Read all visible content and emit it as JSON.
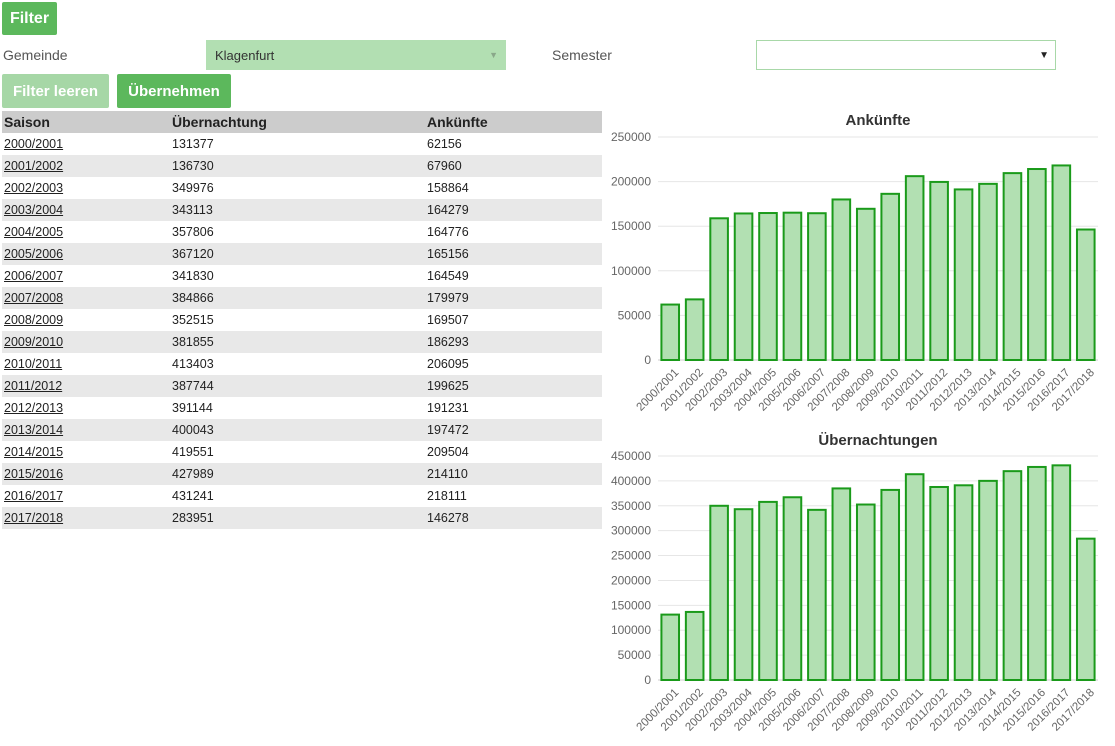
{
  "buttons": {
    "filter": "Filter",
    "clear": "Filter leeren",
    "apply": "Übernehmen"
  },
  "filters": {
    "gemeinde_label": "Gemeinde",
    "gemeinde_value": "Klagenfurt",
    "semester_label": "Semester",
    "semester_value": ""
  },
  "table": {
    "headers": [
      "Saison",
      "Übernachtung",
      "Ankünfte"
    ],
    "rows": [
      [
        "2000/2001",
        "131377",
        "62156"
      ],
      [
        "2001/2002",
        "136730",
        "67960"
      ],
      [
        "2002/2003",
        "349976",
        "158864"
      ],
      [
        "2003/2004",
        "343113",
        "164279"
      ],
      [
        "2004/2005",
        "357806",
        "164776"
      ],
      [
        "2005/2006",
        "367120",
        "165156"
      ],
      [
        "2006/2007",
        "341830",
        "164549"
      ],
      [
        "2007/2008",
        "384866",
        "179979"
      ],
      [
        "2008/2009",
        "352515",
        "169507"
      ],
      [
        "2009/2010",
        "381855",
        "186293"
      ],
      [
        "2010/2011",
        "413403",
        "206095"
      ],
      [
        "2011/2012",
        "387744",
        "199625"
      ],
      [
        "2012/2013",
        "391144",
        "191231"
      ],
      [
        "2013/2014",
        "400043",
        "197472"
      ],
      [
        "2014/2015",
        "419551",
        "209504"
      ],
      [
        "2015/2016",
        "427989",
        "214110"
      ],
      [
        "2016/2017",
        "431241",
        "218111"
      ],
      [
        "2017/2018",
        "283951",
        "146278"
      ]
    ]
  },
  "colors": {
    "bar_fill": "#b2e0b2",
    "bar_stroke": "#1a9a1a",
    "button": "#5cb85c",
    "button_disabled": "#a6d7a6"
  },
  "chart_data": [
    {
      "type": "bar",
      "title": "Ankünfte",
      "categories": [
        "2000/2001",
        "2001/2002",
        "2002/2003",
        "2003/2004",
        "2004/2005",
        "2005/2006",
        "2006/2007",
        "2007/2008",
        "2008/2009",
        "2009/2010",
        "2010/2011",
        "2011/2012",
        "2012/2013",
        "2013/2014",
        "2014/2015",
        "2015/2016",
        "2016/2017",
        "2017/2018"
      ],
      "values": [
        62156,
        67960,
        158864,
        164279,
        164776,
        165156,
        164549,
        179979,
        169507,
        186293,
        206095,
        199625,
        191231,
        197472,
        209504,
        214110,
        218111,
        146278
      ],
      "ylim": [
        0,
        250000
      ],
      "yticks": [
        0,
        50000,
        100000,
        150000,
        200000,
        250000
      ],
      "grid": true
    },
    {
      "type": "bar",
      "title": "Übernachtungen",
      "categories": [
        "2000/2001",
        "2001/2002",
        "2002/2003",
        "2003/2004",
        "2004/2005",
        "2005/2006",
        "2006/2007",
        "2007/2008",
        "2008/2009",
        "2009/2010",
        "2010/2011",
        "2011/2012",
        "2012/2013",
        "2013/2014",
        "2014/2015",
        "2015/2016",
        "2016/2017",
        "2017/2018"
      ],
      "values": [
        131377,
        136730,
        349976,
        343113,
        357806,
        367120,
        341830,
        384866,
        352515,
        381855,
        413403,
        387744,
        391144,
        400043,
        419551,
        427989,
        431241,
        283951
      ],
      "ylim": [
        0,
        450000
      ],
      "yticks": [
        0,
        50000,
        100000,
        150000,
        200000,
        250000,
        300000,
        350000,
        400000,
        450000
      ],
      "grid": true
    }
  ]
}
